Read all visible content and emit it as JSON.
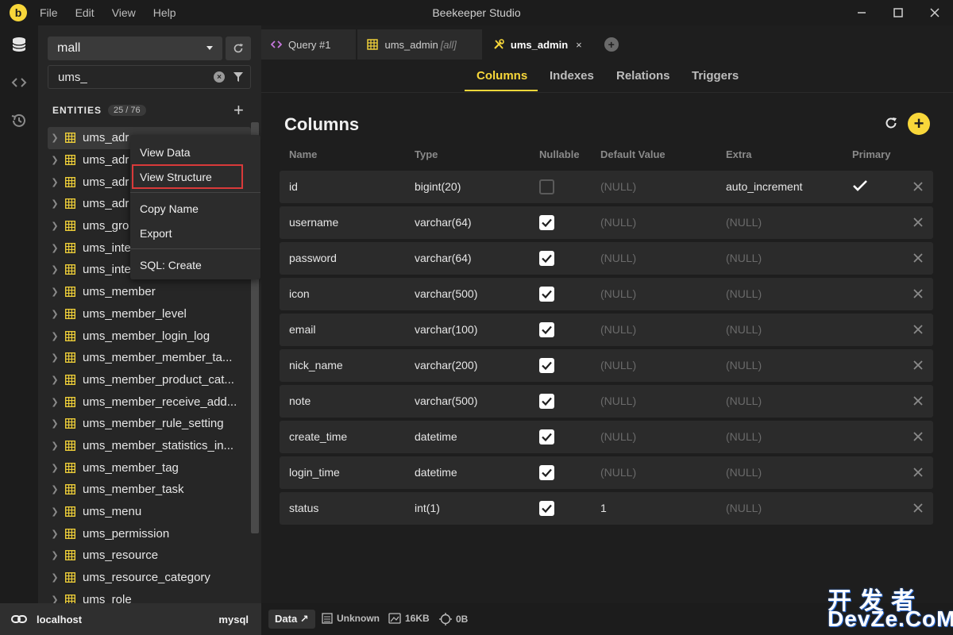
{
  "titlebar": {
    "menu": [
      "File",
      "Edit",
      "View",
      "Help"
    ],
    "title": "Beekeeper Studio"
  },
  "sidebar": {
    "connection": "mall",
    "filter_value": "ums_",
    "entities_label": "ENTITIES",
    "entities_count": "25 / 76",
    "items": [
      "ums_adr",
      "ums_adr",
      "ums_adr",
      "ums_adr",
      "ums_gro",
      "ums_inte",
      "ums_inte",
      "ums_member",
      "ums_member_level",
      "ums_member_login_log",
      "ums_member_member_ta...",
      "ums_member_product_cat...",
      "ums_member_receive_add...",
      "ums_member_rule_setting",
      "ums_member_statistics_in...",
      "ums_member_tag",
      "ums_member_task",
      "ums_menu",
      "ums_permission",
      "ums_resource",
      "ums_resource_category",
      "ums_role"
    ]
  },
  "context_menu": {
    "items": [
      "View Data",
      "View Structure",
      "Copy Name",
      "Export",
      "SQL: Create"
    ]
  },
  "tabs": [
    {
      "label": "Query #1",
      "sub": ""
    },
    {
      "label": "ums_admin",
      "sub": "[all]"
    },
    {
      "label": "ums_admin",
      "sub": "",
      "close": "×"
    }
  ],
  "subtabs": [
    "Columns",
    "Indexes",
    "Relations",
    "Triggers"
  ],
  "panel": {
    "title": "Columns",
    "headers": [
      "Name",
      "Type",
      "Nullable",
      "Default Value",
      "Extra",
      "Primary"
    ],
    "rows": [
      {
        "name": "id",
        "type": "bigint(20)",
        "nullable": false,
        "default": "(NULL)",
        "extra": "auto_increment",
        "primary": true
      },
      {
        "name": "username",
        "type": "varchar(64)",
        "nullable": true,
        "default": "(NULL)",
        "extra": "(NULL)",
        "primary": false
      },
      {
        "name": "password",
        "type": "varchar(64)",
        "nullable": true,
        "default": "(NULL)",
        "extra": "(NULL)",
        "primary": false
      },
      {
        "name": "icon",
        "type": "varchar(500)",
        "nullable": true,
        "default": "(NULL)",
        "extra": "(NULL)",
        "primary": false
      },
      {
        "name": "email",
        "type": "varchar(100)",
        "nullable": true,
        "default": "(NULL)",
        "extra": "(NULL)",
        "primary": false
      },
      {
        "name": "nick_name",
        "type": "varchar(200)",
        "nullable": true,
        "default": "(NULL)",
        "extra": "(NULL)",
        "primary": false
      },
      {
        "name": "note",
        "type": "varchar(500)",
        "nullable": true,
        "default": "(NULL)",
        "extra": "(NULL)",
        "primary": false
      },
      {
        "name": "create_time",
        "type": "datetime",
        "nullable": true,
        "default": "(NULL)",
        "extra": "(NULL)",
        "primary": false
      },
      {
        "name": "login_time",
        "type": "datetime",
        "nullable": true,
        "default": "(NULL)",
        "extra": "(NULL)",
        "primary": false
      },
      {
        "name": "status",
        "type": "int(1)",
        "nullable": true,
        "default": "1",
        "extra": "(NULL)",
        "primary": false
      }
    ]
  },
  "statusbar": {
    "host": "localhost",
    "driver": "mysql",
    "data_label": "Data ↗",
    "engine": "Unknown",
    "size": "16KB",
    "rows": "0B"
  },
  "watermark": {
    "top": "开发者",
    "bottom": "DevZe.CoM"
  },
  "colors": {
    "accent": "#f8d73a",
    "highlight_border": "#d93a3a"
  }
}
